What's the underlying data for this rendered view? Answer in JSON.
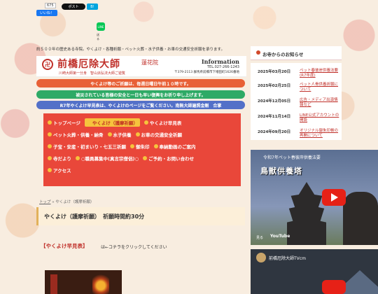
{
  "social": {
    "fb_count": "675",
    "fb_like": "いいね！",
    "x_post": "ポスト",
    "hatena": "B!",
    "line_label": "送る"
  },
  "intro_text": "約５００年の歴史ある寺院。やくよけ・各種祈願・ペット火葬・水子供養・お車の交通安全祈願を承ります。",
  "header": {
    "title": "前橋厄除大師",
    "temple": "蓮花院",
    "subtitle": "川崎大師第一分身　智山派弘法大師ご遊覧",
    "info_label": "Information",
    "tel": "TEL.027-266-1243",
    "address": "〒379-2113 群馬県前橋市下増田町1626番地"
  },
  "banners": [
    "やくよけ等のご祈願は、毎週日曜日午前１０時です。",
    "被災されている皆様の安全と一日も早い復興をお祈り申し上げます。",
    "R7年やくよけ早見表は、やくよけのページをご覧ください。南無大師遍照金剛　合掌"
  ],
  "menu": {
    "rows": [
      [
        "トップページ",
        "やくよけ（護摩祈願）",
        "やくよけ早見表"
      ],
      [
        "ペット火葬・供養・納骨",
        "水子供養",
        "お車の交通安全祈願"
      ],
      [
        "子宝・安産・初まいり・七五三祈願",
        "御朱印",
        "奉納動画のご案内"
      ],
      [
        "寺だより",
        "○職員募集中(真言宗僧侶)○",
        "ご予約・お問い合わせ"
      ],
      [
        "アクセス"
      ]
    ],
    "active": "やくよけ（護摩祈願）"
  },
  "breadcrumb": {
    "home": "トップ",
    "separator": "»",
    "current": "やくよけ（護摩祈願）"
  },
  "page_heading": "やくよけ（護摩祈願）　祈願時間約30分",
  "hayami_link": "【やくよけ早見表】",
  "hayami_suffix": "は←コチラをクリックしてください",
  "sidebar": {
    "news_title": "お寺からのお知らせ",
    "news": [
      {
        "date": "2025年03月20日",
        "text": "ペット春彼岸供養法要(R7年度)"
      },
      {
        "date": "2025年02月25日",
        "text": "ペット人骨供養祈願について"
      },
      {
        "date": "2024年12月05日",
        "text": "広告・メディア出演情報など"
      },
      {
        "date": "2024年11月14日",
        "text": "LINE公式アカウントの開設"
      },
      {
        "date": "2024年09月20日",
        "text": "オリジナル御朱印帳の再開について"
      }
    ]
  },
  "videos": [
    {
      "title": "令和7年ペット春彼岸供養法要",
      "overlay": "鳥獣供養塔",
      "watch": "見る",
      "yt": "YouTube"
    },
    {
      "title": "前橋厄除大師TVcm"
    }
  ]
}
